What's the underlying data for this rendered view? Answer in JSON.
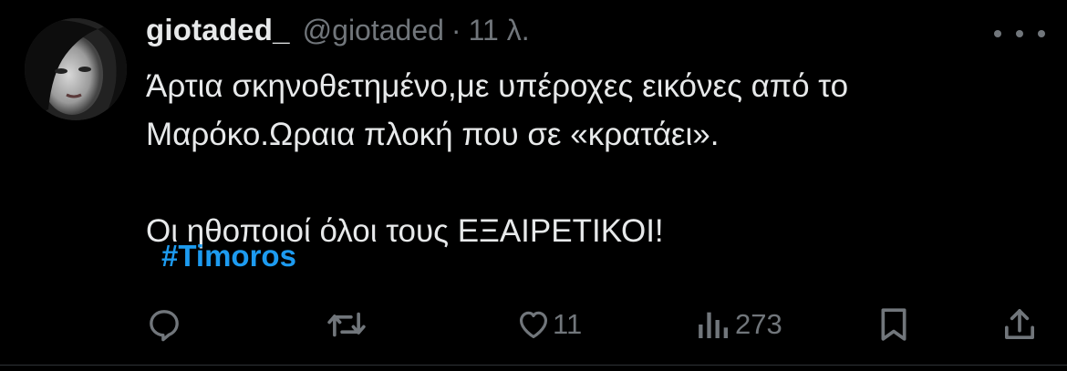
{
  "tweet": {
    "display_name": "giotaded_",
    "handle": "@giotaded",
    "separator": "·",
    "timestamp": "11 λ.",
    "text_lines": [
      "Άρτια σκηνοθετημένο,με υπέροχες εικόνες από το",
      "Μαρόκο.Ωραια πλοκή που σε «κρατάει».",
      "",
      "Οι ηθοποιοί όλοι τους ΕΞΑΙΡΕΤΙΚΟΙ!"
    ],
    "hashtag": "#Timoros"
  },
  "actions": {
    "reply_count": "",
    "retweet_count": "",
    "like_count": "11",
    "view_count": "273"
  },
  "colors": {
    "background": "#000000",
    "text": "#e7e9ea",
    "muted": "#71767b",
    "accent": "#1d9bf0"
  },
  "icons": [
    "avatar",
    "more-icon",
    "reply-icon",
    "retweet-icon",
    "like-icon",
    "views-icon",
    "bookmark-icon",
    "share-icon"
  ]
}
